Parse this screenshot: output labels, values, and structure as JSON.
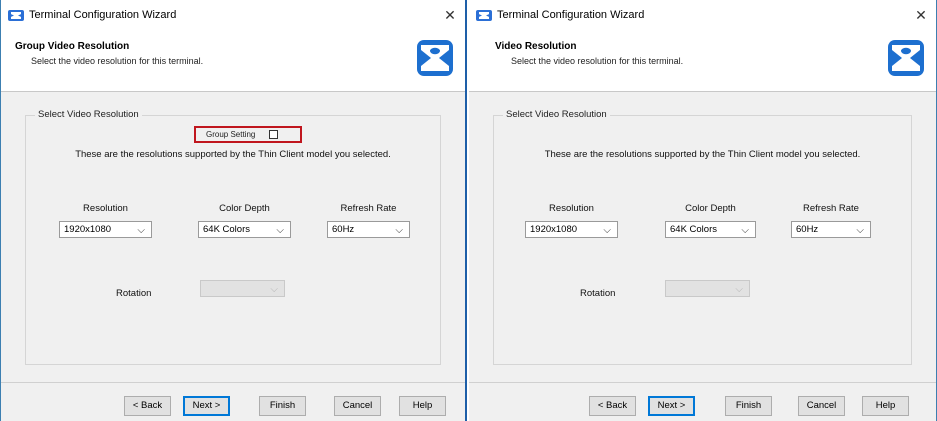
{
  "colors": {
    "accent_border": "#1e5fa8",
    "highlight_box": "#c0161e",
    "default_button": "#0078d7"
  },
  "left_window": {
    "title": "Terminal Configuration Wizard",
    "close_glyph": "✕",
    "header_title": "Group Video Resolution",
    "header_subtitle": "Select the video resolution for this terminal.",
    "group_label": "Select Video Resolution",
    "group_setting_label": "Group Setting",
    "info_text": "These are the resolutions supported by the Thin Client model you selected.",
    "resolution": {
      "label": "Resolution",
      "value": "1920x1080"
    },
    "color_depth": {
      "label": "Color Depth",
      "value": "64K Colors"
    },
    "refresh_rate": {
      "label": "Refresh Rate",
      "value": "60Hz"
    },
    "rotation": {
      "label": "Rotation",
      "value": ""
    },
    "buttons": {
      "back": "< Back",
      "next": "Next >",
      "finish": "Finish",
      "cancel": "Cancel",
      "help": "Help"
    }
  },
  "right_window": {
    "title": "Terminal Configuration Wizard",
    "close_glyph": "✕",
    "header_title": "Video Resolution",
    "header_subtitle": "Select the video resolution for this terminal.",
    "group_label": "Select Video Resolution",
    "info_text": "These are the resolutions supported by the Thin Client model you selected.",
    "resolution": {
      "label": "Resolution",
      "value": "1920x1080"
    },
    "color_depth": {
      "label": "Color Depth",
      "value": "64K Colors"
    },
    "refresh_rate": {
      "label": "Refresh Rate",
      "value": "60Hz"
    },
    "rotation": {
      "label": "Rotation",
      "value": ""
    },
    "buttons": {
      "back": "< Back",
      "next": "Next >",
      "finish": "Finish",
      "cancel": "Cancel",
      "help": "Help"
    }
  },
  "icons": {
    "app": "terminal-services-icon",
    "logo": "thinmanager-logo-icon",
    "close": "close-icon",
    "dropdown": "chevron-down-icon"
  }
}
